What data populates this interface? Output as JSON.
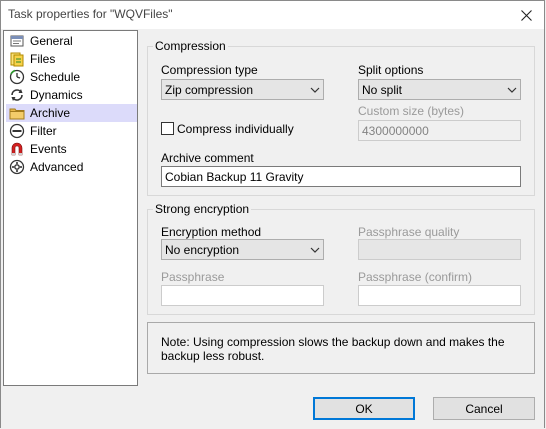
{
  "window": {
    "title": "Task properties for \"WQVFiles\""
  },
  "sidebar": {
    "items": [
      {
        "label": "General",
        "icon": "general-icon"
      },
      {
        "label": "Files",
        "icon": "files-icon"
      },
      {
        "label": "Schedule",
        "icon": "schedule-icon"
      },
      {
        "label": "Dynamics",
        "icon": "dynamics-icon"
      },
      {
        "label": "Archive",
        "icon": "archive-folder-icon",
        "selected": true
      },
      {
        "label": "Filter",
        "icon": "filter-icon"
      },
      {
        "label": "Events",
        "icon": "events-magnet-icon"
      },
      {
        "label": "Advanced",
        "icon": "advanced-gear-icon"
      }
    ],
    "selected_color": "#dcdbfa"
  },
  "compression": {
    "group_title": "Compression",
    "type_label": "Compression type",
    "type_value": "Zip compression",
    "split_label": "Split options",
    "split_value": "No split",
    "custom_size_label": "Custom size (bytes)",
    "custom_size_value": "4300000000",
    "compress_individually_label": "Compress individually",
    "compress_individually_checked": false,
    "archive_comment_label": "Archive comment",
    "archive_comment_value": "Cobian Backup 11 Gravity"
  },
  "encryption": {
    "group_title": "Strong encryption",
    "method_label": "Encryption method",
    "method_value": "No encryption",
    "quality_label": "Passphrase quality",
    "passphrase_label": "Passphrase",
    "passphrase_confirm_label": "Passphrase (confirm)"
  },
  "note": {
    "text": "Note: Using compression slows the backup down and makes the backup less robust."
  },
  "buttons": {
    "ok": "OK",
    "cancel": "Cancel"
  },
  "colors": {
    "accent": "#0078d7"
  }
}
